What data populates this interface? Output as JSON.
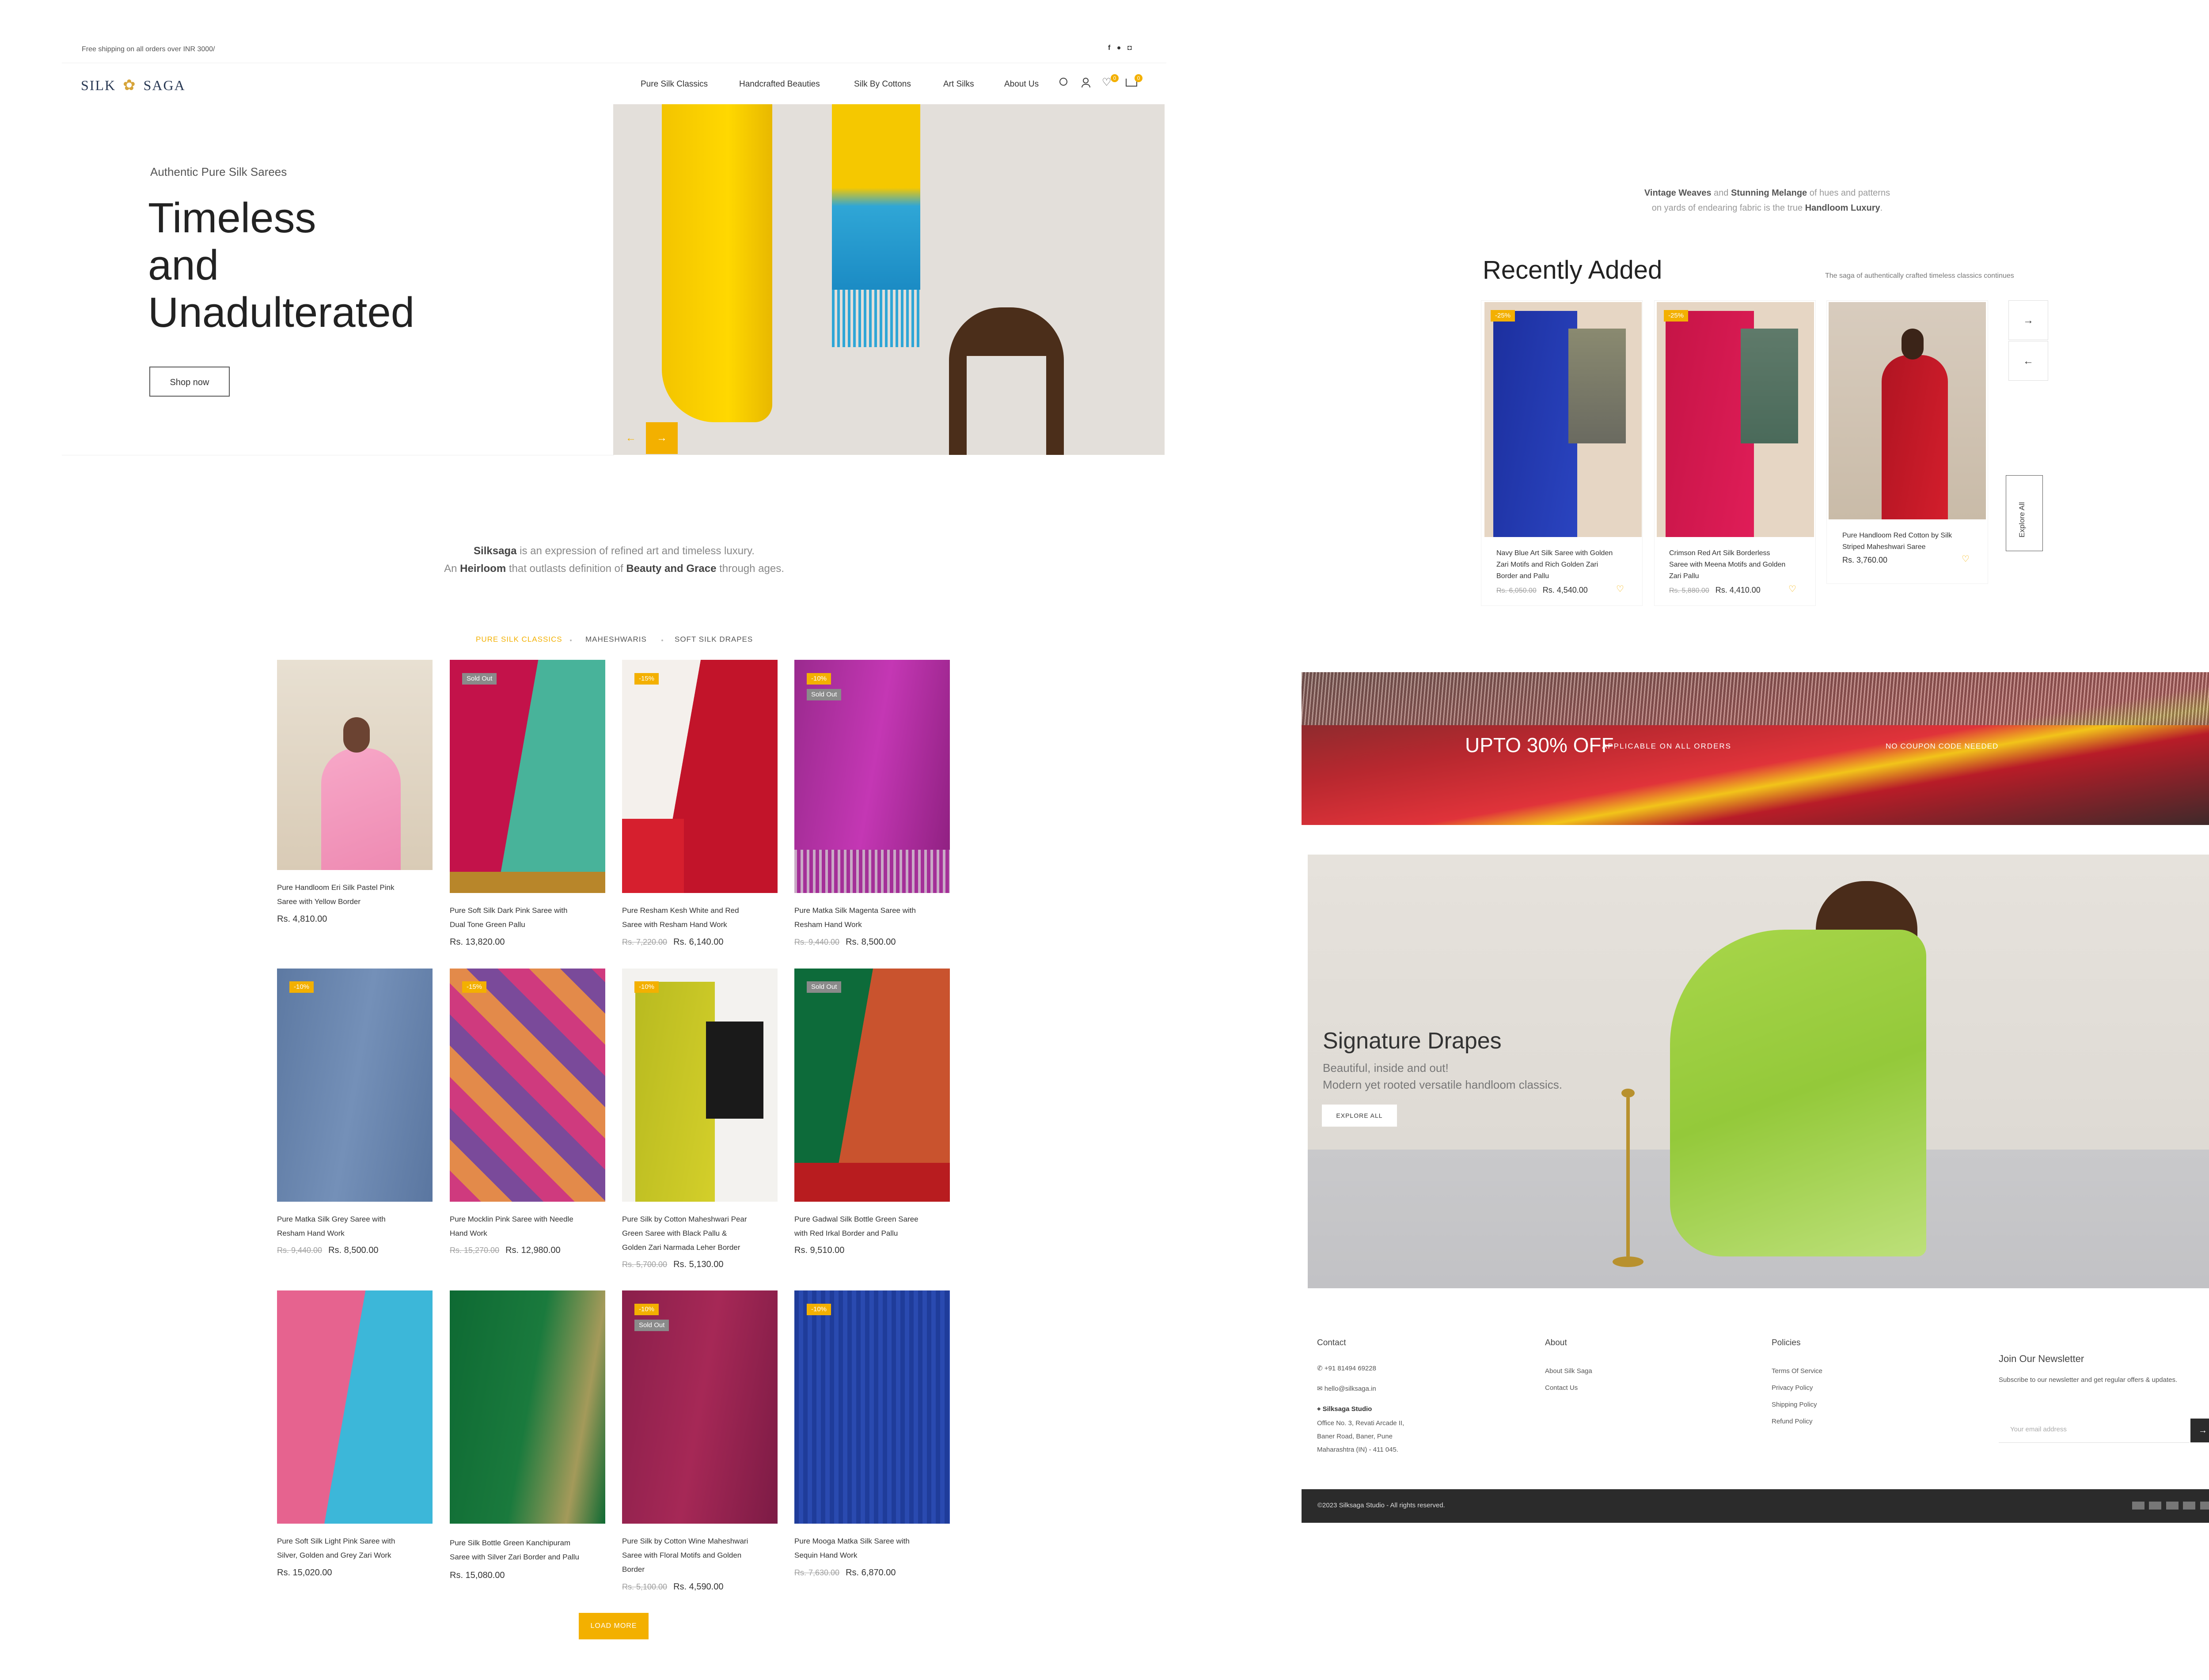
{
  "topbar": {
    "shipping_text": "Free shipping on all orders over INR 3000/"
  },
  "header": {
    "logo_left": "SILK",
    "logo_right": "SAGA",
    "nav": [
      "Pure Silk Classics",
      "Handcrafted Beauties",
      "Silk By Cottons",
      "Art Silks",
      "About Us"
    ],
    "wishlist_count": "0",
    "cart_count": "0"
  },
  "hero": {
    "eyebrow": "Authentic Pure Silk Sarees",
    "title_lines": [
      "Timeless",
      "and",
      "Unadulterated"
    ],
    "cta": "Shop now"
  },
  "intro": {
    "brand": "Silksaga",
    "line1_rest": " is an expression of refined art and timeless luxury.",
    "line2_a": "An ",
    "line2_b": "Heirloom",
    "line2_c": " that outlasts definition of ",
    "line2_d": "Beauty and Grace",
    "line2_e": " through ages."
  },
  "tabs": [
    "PURE SILK CLASSICS",
    "MAHESHWARIS",
    "SOFT SILK DRAPES"
  ],
  "products": [
    {
      "name_lines": [
        "Pure Handloom Eri Silk Pastel Pink",
        "Saree with Yellow Border"
      ],
      "old_price": "",
      "price": "Rs. 4,810.00",
      "discount": "",
      "sold": ""
    },
    {
      "name_lines": [
        "Pure Soft Silk Dark Pink Saree with",
        "Dual Tone Green Pallu"
      ],
      "old_price": "",
      "price": "Rs. 13,820.00",
      "discount": "",
      "sold": "Sold Out"
    },
    {
      "name_lines": [
        "Pure Resham Kesh White and Red",
        "Saree with Resham Hand Work"
      ],
      "old_price": "Rs. 7,220.00",
      "price": "Rs. 6,140.00",
      "discount": "-15%",
      "sold": ""
    },
    {
      "name_lines": [
        "Pure Matka Silk Magenta Saree with",
        "Resham Hand Work"
      ],
      "old_price": "Rs. 9,440.00",
      "price": "Rs. 8,500.00",
      "discount": "-10%",
      "sold": "Sold Out"
    },
    {
      "name_lines": [
        "Pure Matka Silk Grey Saree with",
        "Resham Hand Work"
      ],
      "old_price": "Rs. 9,440.00",
      "price": "Rs. 8,500.00",
      "discount": "-10%",
      "sold": ""
    },
    {
      "name_lines": [
        "Pure Mocklin Pink Saree with Needle",
        "Hand Work"
      ],
      "old_price": "Rs. 15,270.00",
      "price": "Rs. 12,980.00",
      "discount": "-15%",
      "sold": ""
    },
    {
      "name_lines": [
        "Pure Silk by Cotton Maheshwari Pear",
        "Green Saree with Black Pallu &",
        "Golden Zari Narmada Leher Border"
      ],
      "old_price": "Rs. 5,700.00",
      "price": "Rs. 5,130.00",
      "discount": "-10%",
      "sold": ""
    },
    {
      "name_lines": [
        "Pure Gadwal Silk Bottle Green Saree",
        "with Red Irkal Border and Pallu"
      ],
      "old_price": "",
      "price": "Rs. 9,510.00",
      "discount": "",
      "sold": "Sold Out"
    },
    {
      "name_lines": [
        "Pure Soft Silk Light Pink Saree with",
        "Silver, Golden and Grey Zari Work"
      ],
      "old_price": "",
      "price": "Rs. 15,020.00",
      "discount": "",
      "sold": ""
    },
    {
      "name_lines": [
        "Pure Silk Bottle Green Kanchipuram",
        "Saree with Silver Zari Border and Pallu"
      ],
      "old_price": "",
      "price": "Rs. 15,080.00",
      "discount": "",
      "sold": ""
    },
    {
      "name_lines": [
        "Pure Silk by Cotton Wine Maheshwari",
        "Saree with Floral Motifs and Golden",
        "Border"
      ],
      "old_price": "Rs. 5,100.00",
      "price": "Rs. 4,590.00",
      "discount": "-10%",
      "sold": "Sold Out"
    },
    {
      "name_lines": [
        "Pure Mooga Matka Silk Saree with",
        "Sequin Hand Work"
      ],
      "old_price": "Rs. 7,630.00",
      "price": "Rs. 6,870.00",
      "discount": "-10%",
      "sold": ""
    }
  ],
  "load_more": "LOAD MORE",
  "vintage": {
    "a": "Vintage Weaves",
    "b": " and ",
    "c": "Stunning Melange",
    "d": " of hues and patterns",
    "e": "on yards of endearing fabric is the true ",
    "f": "Handloom Luxury",
    "g": "."
  },
  "recent": {
    "title": "Recently Added",
    "subtitle": "The saga of authentically crafted timeless classics continues",
    "explore": "Explore All",
    "items": [
      {
        "name_lines": [
          "Navy Blue Art Silk Saree with Golden",
          "Zari Motifs and Rich Golden Zari",
          "Border and Pallu"
        ],
        "old_price": "Rs. 6,050.00",
        "price": "Rs. 4,540.00",
        "discount": "-25%"
      },
      {
        "name_lines": [
          "Crimson Red Art Silk Borderless",
          "Saree with Meena Motifs and Golden",
          "Zari Pallu"
        ],
        "old_price": "Rs. 5,880.00",
        "price": "Rs. 4,410.00",
        "discount": "-25%"
      },
      {
        "name_lines": [
          "Pure Handloom Red Cotton by Silk",
          "Striped Maheshwari Saree"
        ],
        "old_price": "",
        "price": "Rs. 3,760.00",
        "discount": ""
      }
    ]
  },
  "banner": {
    "big": "UPTO 30% OFF",
    "small": "APPLICABLE ON ALL ORDERS",
    "right": "NO COUPON CODE NEEDED"
  },
  "signature": {
    "title": "Signature Drapes",
    "line1": "Beautiful, inside and out!",
    "line2": "Modern yet rooted versatile handloom classics.",
    "cta": "EXPLORE ALL"
  },
  "footer": {
    "contact_h": "Contact",
    "phone": "+91 81494 69228",
    "email": "hello@silksaga.in",
    "studio": "Silksaga Studio",
    "address": [
      "Office No. 3, Revati Arcade II,",
      "Baner Road, Baner, Pune",
      "Maharashtra (IN) - 411 045."
    ],
    "about_h": "About",
    "about_links": [
      "About Silk Saga",
      "Contact Us"
    ],
    "policies_h": "Policies",
    "policy_links": [
      "Terms Of Service",
      "Privacy Policy",
      "Shipping Policy",
      "Refund Policy"
    ],
    "newsletter_h": "Join Our Newsletter",
    "newsletter_text": "Subscribe to our newsletter and get regular offers & updates.",
    "email_placeholder": "Your email address",
    "copyright": "©2023 Silksaga Studio - All rights reserved."
  },
  "colors": {
    "accent": "#f3b000",
    "dark": "#2b2b2b"
  }
}
